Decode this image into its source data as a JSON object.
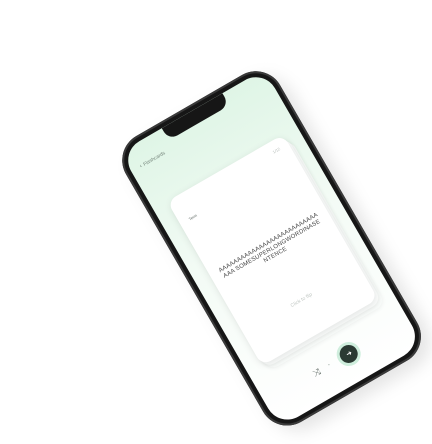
{
  "header": {
    "back_label": "Flashcards"
  },
  "card": {
    "counter": "1/12",
    "label": "Term",
    "term": "AAAAAAAAAAAAAAAAAAAAAAAAAAAAAA SOMESUPERLONGWORDINASENTENCE",
    "hint": "Click to flip"
  },
  "controls": {
    "shuffle_icon": "shuffle-icon",
    "dot_text": "•",
    "next_icon": "arrow-right-icon"
  },
  "colors": {
    "accent_bg": "#dff5e6",
    "button": "#2b3a33",
    "button_ring": "#cfeedd"
  }
}
